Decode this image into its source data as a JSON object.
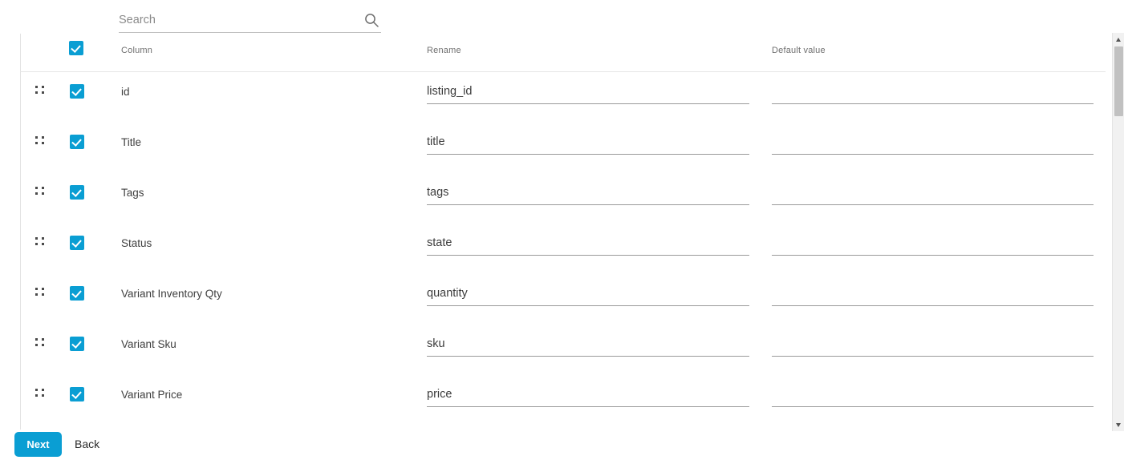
{
  "search": {
    "placeholder": "Search",
    "value": "",
    "icon": "search-icon"
  },
  "table": {
    "headers": {
      "column": "Column",
      "rename": "Rename",
      "default_value": "Default value"
    },
    "select_all_checked": true,
    "rows": [
      {
        "column": "id",
        "rename": "listing_id",
        "default_value": "",
        "checked": true,
        "handle": "drag-handle-icon"
      },
      {
        "column": "Title",
        "rename": "title",
        "default_value": "",
        "checked": true,
        "handle": "drag-handle-icon"
      },
      {
        "column": "Tags",
        "rename": "tags",
        "default_value": "",
        "checked": true,
        "handle": "drag-handle-icon"
      },
      {
        "column": "Status",
        "rename": "state",
        "default_value": "",
        "checked": true,
        "handle": "drag-handle-icon"
      },
      {
        "column": "Variant Inventory Qty",
        "rename": "quantity",
        "default_value": "",
        "checked": true,
        "handle": "drag-handle-icon"
      },
      {
        "column": "Variant Sku",
        "rename": "sku",
        "default_value": "",
        "checked": true,
        "handle": "drag-handle-icon"
      },
      {
        "column": "Variant Price",
        "rename": "price",
        "default_value": "",
        "checked": true,
        "handle": "drag-handle-icon"
      }
    ]
  },
  "footer": {
    "next_label": "Next",
    "back_label": "Back"
  },
  "scrollbar": {
    "up_icon": "chevron-up-icon",
    "down_icon": "chevron-down-icon"
  },
  "colors": {
    "accent": "#0a9ed3",
    "text": "#3f3f3f",
    "muted": "#6f6f6f",
    "rule": "#e6e6e6",
    "field_underline": "#9a9a9a",
    "scroll_thumb": "#c1c1c1"
  }
}
